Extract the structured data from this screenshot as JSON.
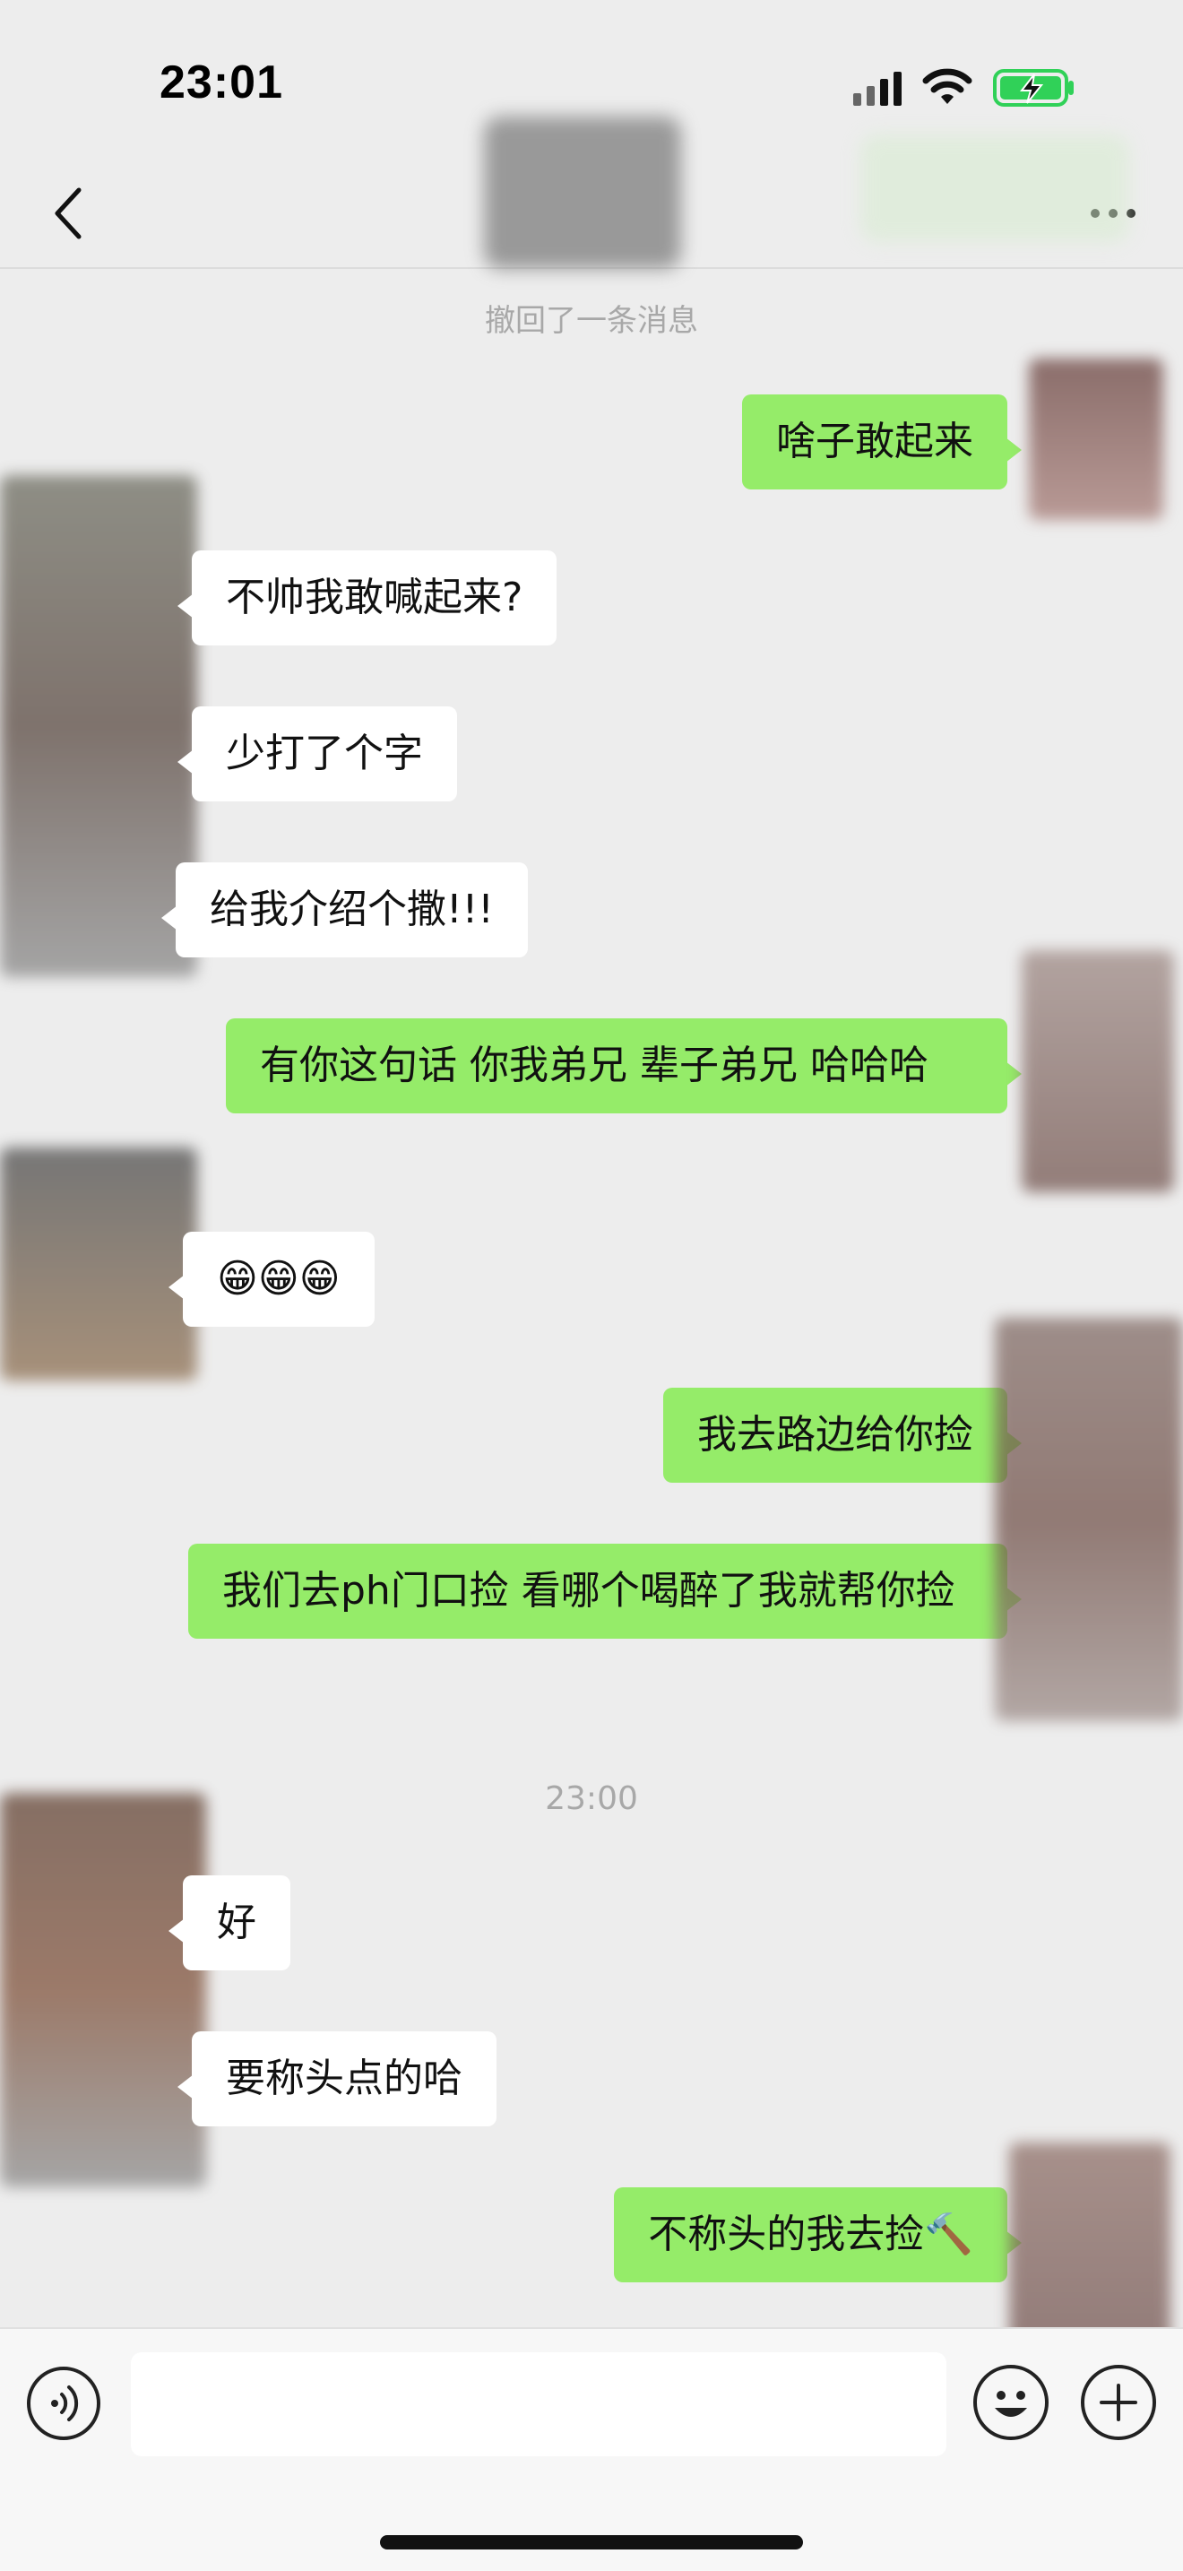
{
  "status_bar": {
    "time": "23:01",
    "signal_icon": "cellular-signal-icon",
    "wifi_icon": "wifi-icon",
    "battery_icon": "battery-charging-icon",
    "battery_color": "#30d158"
  },
  "nav": {
    "title": "",
    "back_icon": "chevron-left-icon",
    "more_icon": "more-dots-icon"
  },
  "messages": {
    "system_note": "撤回了一条消息",
    "m1": "啥子敢起来",
    "m2": "不帅我敢喊起来?",
    "m3": "少打了个字",
    "m4": "给我介绍个撒!!!",
    "m5": "有你这句话 你我弟兄 辈子弟兄 哈哈哈",
    "m6": "😁😁😁",
    "m7": "我去路边给你捡",
    "m8": "我们去ph门口捡 看哪个喝醉了我就帮你捡",
    "timestamp": "23:00",
    "m9": "好",
    "m10": "要称头点的哈",
    "m11": "不称头的我去捡🔨"
  },
  "input_bar": {
    "voice_icon": "voice-icon",
    "text_value": "",
    "emoji_icon": "emoji-icon",
    "plus_icon": "plus-icon"
  },
  "colors": {
    "background": "#ededed",
    "outgoing_bubble": "#95ec69",
    "incoming_bubble": "#ffffff"
  }
}
